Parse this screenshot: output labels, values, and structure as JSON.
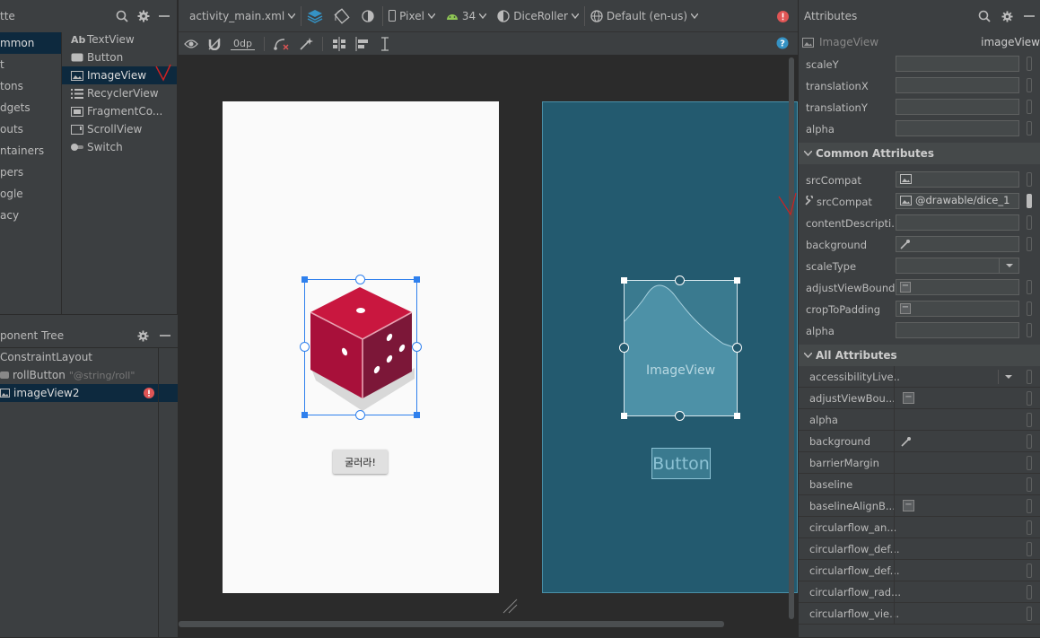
{
  "palette": {
    "title": "tte",
    "categories": [
      "mmon",
      "t",
      "tons",
      "dgets",
      "outs",
      "ntainers",
      "pers",
      "ogle",
      "acy"
    ],
    "selected_category": 0,
    "components": [
      {
        "prefix": "Ab",
        "label": "TextView",
        "icon": "textview-icon"
      },
      {
        "prefix": "",
        "label": "Button",
        "icon": "button-icon"
      },
      {
        "prefix": "",
        "label": "ImageView",
        "icon": "image-icon"
      },
      {
        "prefix": "",
        "label": "RecyclerView",
        "icon": "list-icon"
      },
      {
        "prefix": "",
        "label": "FragmentCo...",
        "icon": "fragment-icon"
      },
      {
        "prefix": "",
        "label": "ScrollView",
        "icon": "scrollview-icon"
      },
      {
        "prefix": "",
        "label": "Switch",
        "icon": "switch-icon"
      }
    ],
    "selected_component": 2
  },
  "tree": {
    "title": "ponent Tree",
    "root": "ConstraintLayout",
    "items": [
      {
        "label": "rollButton",
        "hint": "\"@string/roll\""
      },
      {
        "label": "imageView2",
        "hint": ""
      }
    ]
  },
  "toolbar": {
    "file": "activity_main.xml",
    "device": "Pixel",
    "api": "34",
    "theme": "DiceRoller",
    "locale": "Default (en-us)",
    "margin": "0dp"
  },
  "design": {
    "button_label": "굴러라!",
    "blueprint_image_label": "ImageView",
    "blueprint_button_label": "Button"
  },
  "attributes": {
    "title": "Attributes",
    "widget_type": "ImageView",
    "widget_id": "imageView",
    "transform_rows": [
      "scaleY",
      "translationX",
      "translationY",
      "alpha"
    ],
    "common_title": "Common Attributes",
    "common_rows": [
      {
        "label": "srcCompat",
        "value": ""
      },
      {
        "label": "srcCompat",
        "value": "@drawable/dice_1"
      },
      {
        "label": "contentDescripti...",
        "value": ""
      },
      {
        "label": "background",
        "value": ""
      },
      {
        "label": "scaleType",
        "value": ""
      },
      {
        "label": "adjustViewBounds",
        "value": ""
      },
      {
        "label": "cropToPadding",
        "value": ""
      },
      {
        "label": "alpha",
        "value": ""
      }
    ],
    "all_title": "All Attributes",
    "all_rows": [
      "accessibilityLive...",
      "adjustViewBou...",
      "alpha",
      "background",
      "barrierMargin",
      "baseline",
      "baselineAlignB...",
      "circularflow_an...",
      "circularflow_def...",
      "circularflow_def...",
      "circularflow_rad...",
      "circularflow_vie..."
    ]
  },
  "colors": {
    "accent": "#2f65ca",
    "selection": "#0d293e",
    "blueprint": "#235a6f",
    "dice": "#b0173f",
    "error": "#e05555",
    "annotation": "#cc2222"
  }
}
